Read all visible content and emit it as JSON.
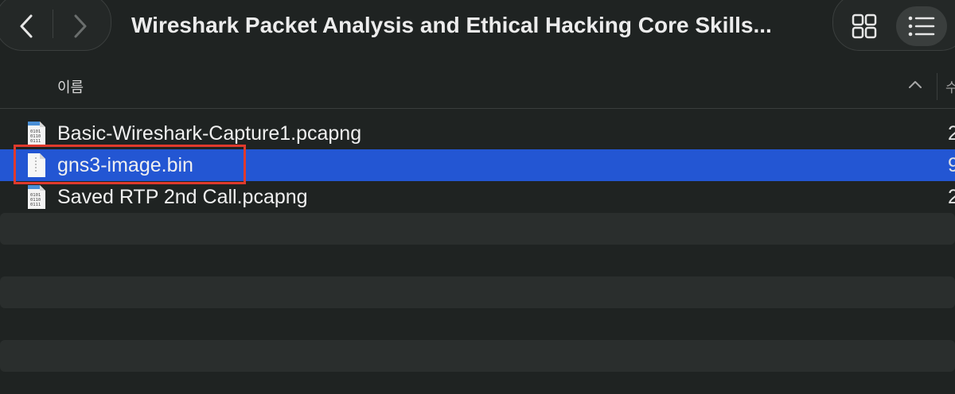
{
  "toolbar": {
    "title": "Wireshark Packet Analysis and Ethical Hacking Core Skills..."
  },
  "columns": {
    "name": "이름",
    "next": "수"
  },
  "files": [
    {
      "name": "Basic-Wireshark-Capture1.pcapng",
      "size": "2",
      "icon": "pcapng-file-icon",
      "selected": false
    },
    {
      "name": "gns3-image.bin",
      "size": "9",
      "icon": "binary-file-icon",
      "selected": true
    },
    {
      "name": "Saved RTP 2nd Call.pcapng",
      "size": "2",
      "icon": "pcapng-file-icon",
      "selected": false
    }
  ],
  "colors": {
    "background": "#1f2322",
    "selection": "#2356d3",
    "highlight": "#e03a2d"
  }
}
